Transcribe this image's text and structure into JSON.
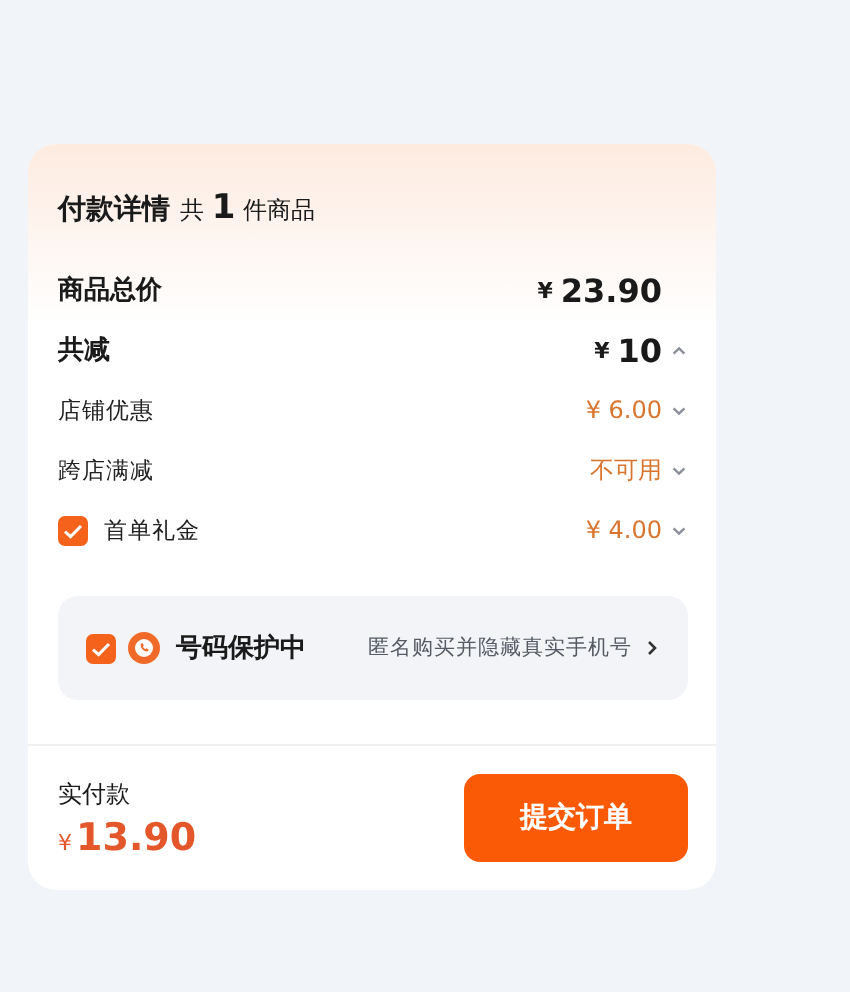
{
  "header": {
    "title": "付款详情",
    "count_prefix": "共",
    "count": "1",
    "count_suffix": "件商品"
  },
  "totals": [
    {
      "label": "商品总价",
      "currency": "¥",
      "amount": "23.90"
    },
    {
      "label": "共减",
      "currency": "¥",
      "amount": "10",
      "expanded": true
    }
  ],
  "discounts": [
    {
      "kind": "plain",
      "label": "店铺优惠",
      "value": "¥ 6.00",
      "expanded": false
    },
    {
      "kind": "plain",
      "label": "跨店满减",
      "value": "不可用",
      "expanded": false
    },
    {
      "kind": "checkbox",
      "label": "首单礼金",
      "checked": true,
      "value": "¥ 4.00",
      "expanded": false
    }
  ],
  "number_protection": {
    "checked": true,
    "title": "号码保护中",
    "note": "匿名购买并隐藏真实手机号"
  },
  "footer": {
    "label": "实付款",
    "currency": "¥",
    "amount": "13.90",
    "submit_button": "提交订单"
  }
}
